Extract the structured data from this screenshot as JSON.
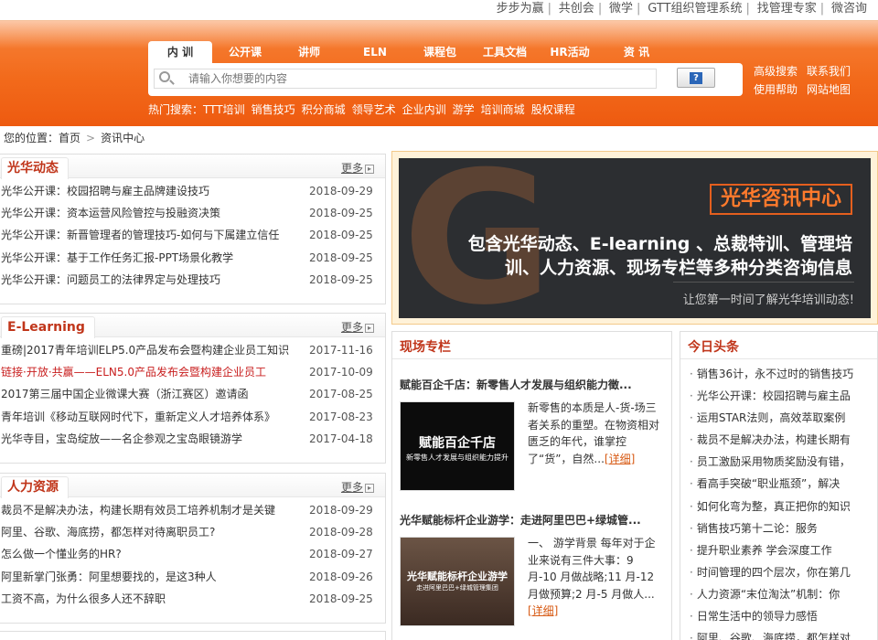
{
  "toplinks": [
    "步步为赢",
    "共创会",
    "微学",
    "GTT组织管理系统",
    "找管理专家",
    "微咨询"
  ],
  "tabs": [
    "内 训",
    "公开课",
    "讲师",
    "ELN",
    "课程包",
    "工具文档",
    "HR活动",
    "资 讯"
  ],
  "search": {
    "placeholder": "请输入你想要的内容",
    "button_icon": "question-icon"
  },
  "header_links": [
    "高级搜索",
    "联系我们",
    "使用帮助",
    "网站地图"
  ],
  "hot": {
    "label": "热门搜索：",
    "items": [
      "TTT培训",
      "销售技巧",
      "积分商城",
      "领导艺术",
      "企业内训",
      "游学",
      "培训商城",
      "股权课程"
    ]
  },
  "breadcrumb": {
    "prefix": "您的位置：",
    "home": "首页",
    "current": "资讯中心"
  },
  "more_label": "更多",
  "panels": [
    {
      "title": "光华动态",
      "items": [
        {
          "title": "光华公开课：校园招聘与雇主品牌建设技巧",
          "date": "2018-09-29"
        },
        {
          "title": "光华公开课：资本运营风险管控与投融资决策",
          "date": "2018-09-25"
        },
        {
          "title": "光华公开课：新晋管理者的管理技巧-如何与下属建立信任",
          "date": "2018-09-25"
        },
        {
          "title": "光华公开课：基于工作任务汇报-PPT场景化教学",
          "date": "2018-09-25"
        },
        {
          "title": "光华公开课：问题员工的法律界定与处理技巧",
          "date": "2018-09-25"
        }
      ]
    },
    {
      "title": "E-Learning",
      "items": [
        {
          "title": "重磅|2017青年培训ELP5.0产品发布会暨构建企业员工知识",
          "date": "2017-11-16",
          "red": false
        },
        {
          "title": "链接·开放·共赢——ELN5.0产品发布会暨构建企业员工",
          "date": "2017-10-09",
          "red": true
        },
        {
          "title": "2017第三届中国企业微课大赛（浙江赛区）邀请函",
          "date": "2017-08-25",
          "red": false
        },
        {
          "title": "青年培训《移动互联网时代下，重新定义人才培养体系》",
          "date": "2017-08-23",
          "red": false
        },
        {
          "title": "光华寺目，宝岛绽放——名企参观之宝岛眼镜游学",
          "date": "2017-04-18",
          "red": false
        }
      ]
    },
    {
      "title": "人力资源",
      "items": [
        {
          "title": "裁员不是解决办法，构建长期有效员工培养机制才是关键",
          "date": "2018-09-29"
        },
        {
          "title": "阿里、谷歌、海底捞，都怎样对待离职员工?",
          "date": "2018-09-28"
        },
        {
          "title": "怎么做一个懂业务的HR?",
          "date": "2018-09-27"
        },
        {
          "title": "阿里新掌门张勇：阿里想要找的，是这3种人",
          "date": "2018-09-26"
        },
        {
          "title": "工资不高，为什么很多人还不辞职",
          "date": "2018-09-25"
        }
      ]
    }
  ],
  "banner": {
    "logo_letter": "G",
    "title": "光华咨讯中心",
    "line1": "包含光华动态、E-learning 、总裁特训、管理培",
    "line2": "训、人力资源、现场专栏等多种分类咨询信息",
    "sub": "让您第一时间了解光华培训动态!"
  },
  "xianchang": {
    "title": "现场专栏",
    "items": [
      {
        "title": "赋能百企千店：新零售人才发展与组织能力徵...",
        "thumb_title": "赋能百企千店",
        "thumb_sub": "新零售人才发展与组织能力提升",
        "desc": "新零售的本质是人-货-场三者关系的重塑。在物资相对匮乏的年代，谁掌控了“货”，自然...",
        "detail": "[详细]"
      },
      {
        "title": "光华赋能标杆企业游学：走进阿里巴巴+绿城管...",
        "thumb_title": "光华赋能标杆企业游学",
        "thumb_sub": "走进阿里巴巴+绿城管理集团",
        "desc": "一、 游学背景 每年对于企业来说有三件大事：9 月-10 月做战略;11 月-12 月做预算;2 月-5 月做人...",
        "detail": "[详细]"
      }
    ]
  },
  "toutiao": {
    "title": "今日头条",
    "items": [
      "销售36计，永不过时的销售技巧",
      "光华公开课：校园招聘与雇主品",
      "运用STAR法则，高效萃取案例",
      "裁员不是解决办法，构建长期有",
      "员工激励采用物质奖励没有错，",
      "看高手突破“职业瓶颈”，解决",
      "如何化弯为整，真正把你的知识",
      "销售技巧第十二论：服务",
      "提升职业素养 学会深度工作",
      "时间管理的四个层次，你在第几",
      "人力资源“末位淘汰”机制：你",
      "日常生活中的领导力感悟",
      "阿里、谷歌、海底捞，都怎样对"
    ]
  },
  "colors": {
    "accent": "#f26a1b",
    "title_red": "#c0351a",
    "link_red": "#c81e1e"
  }
}
